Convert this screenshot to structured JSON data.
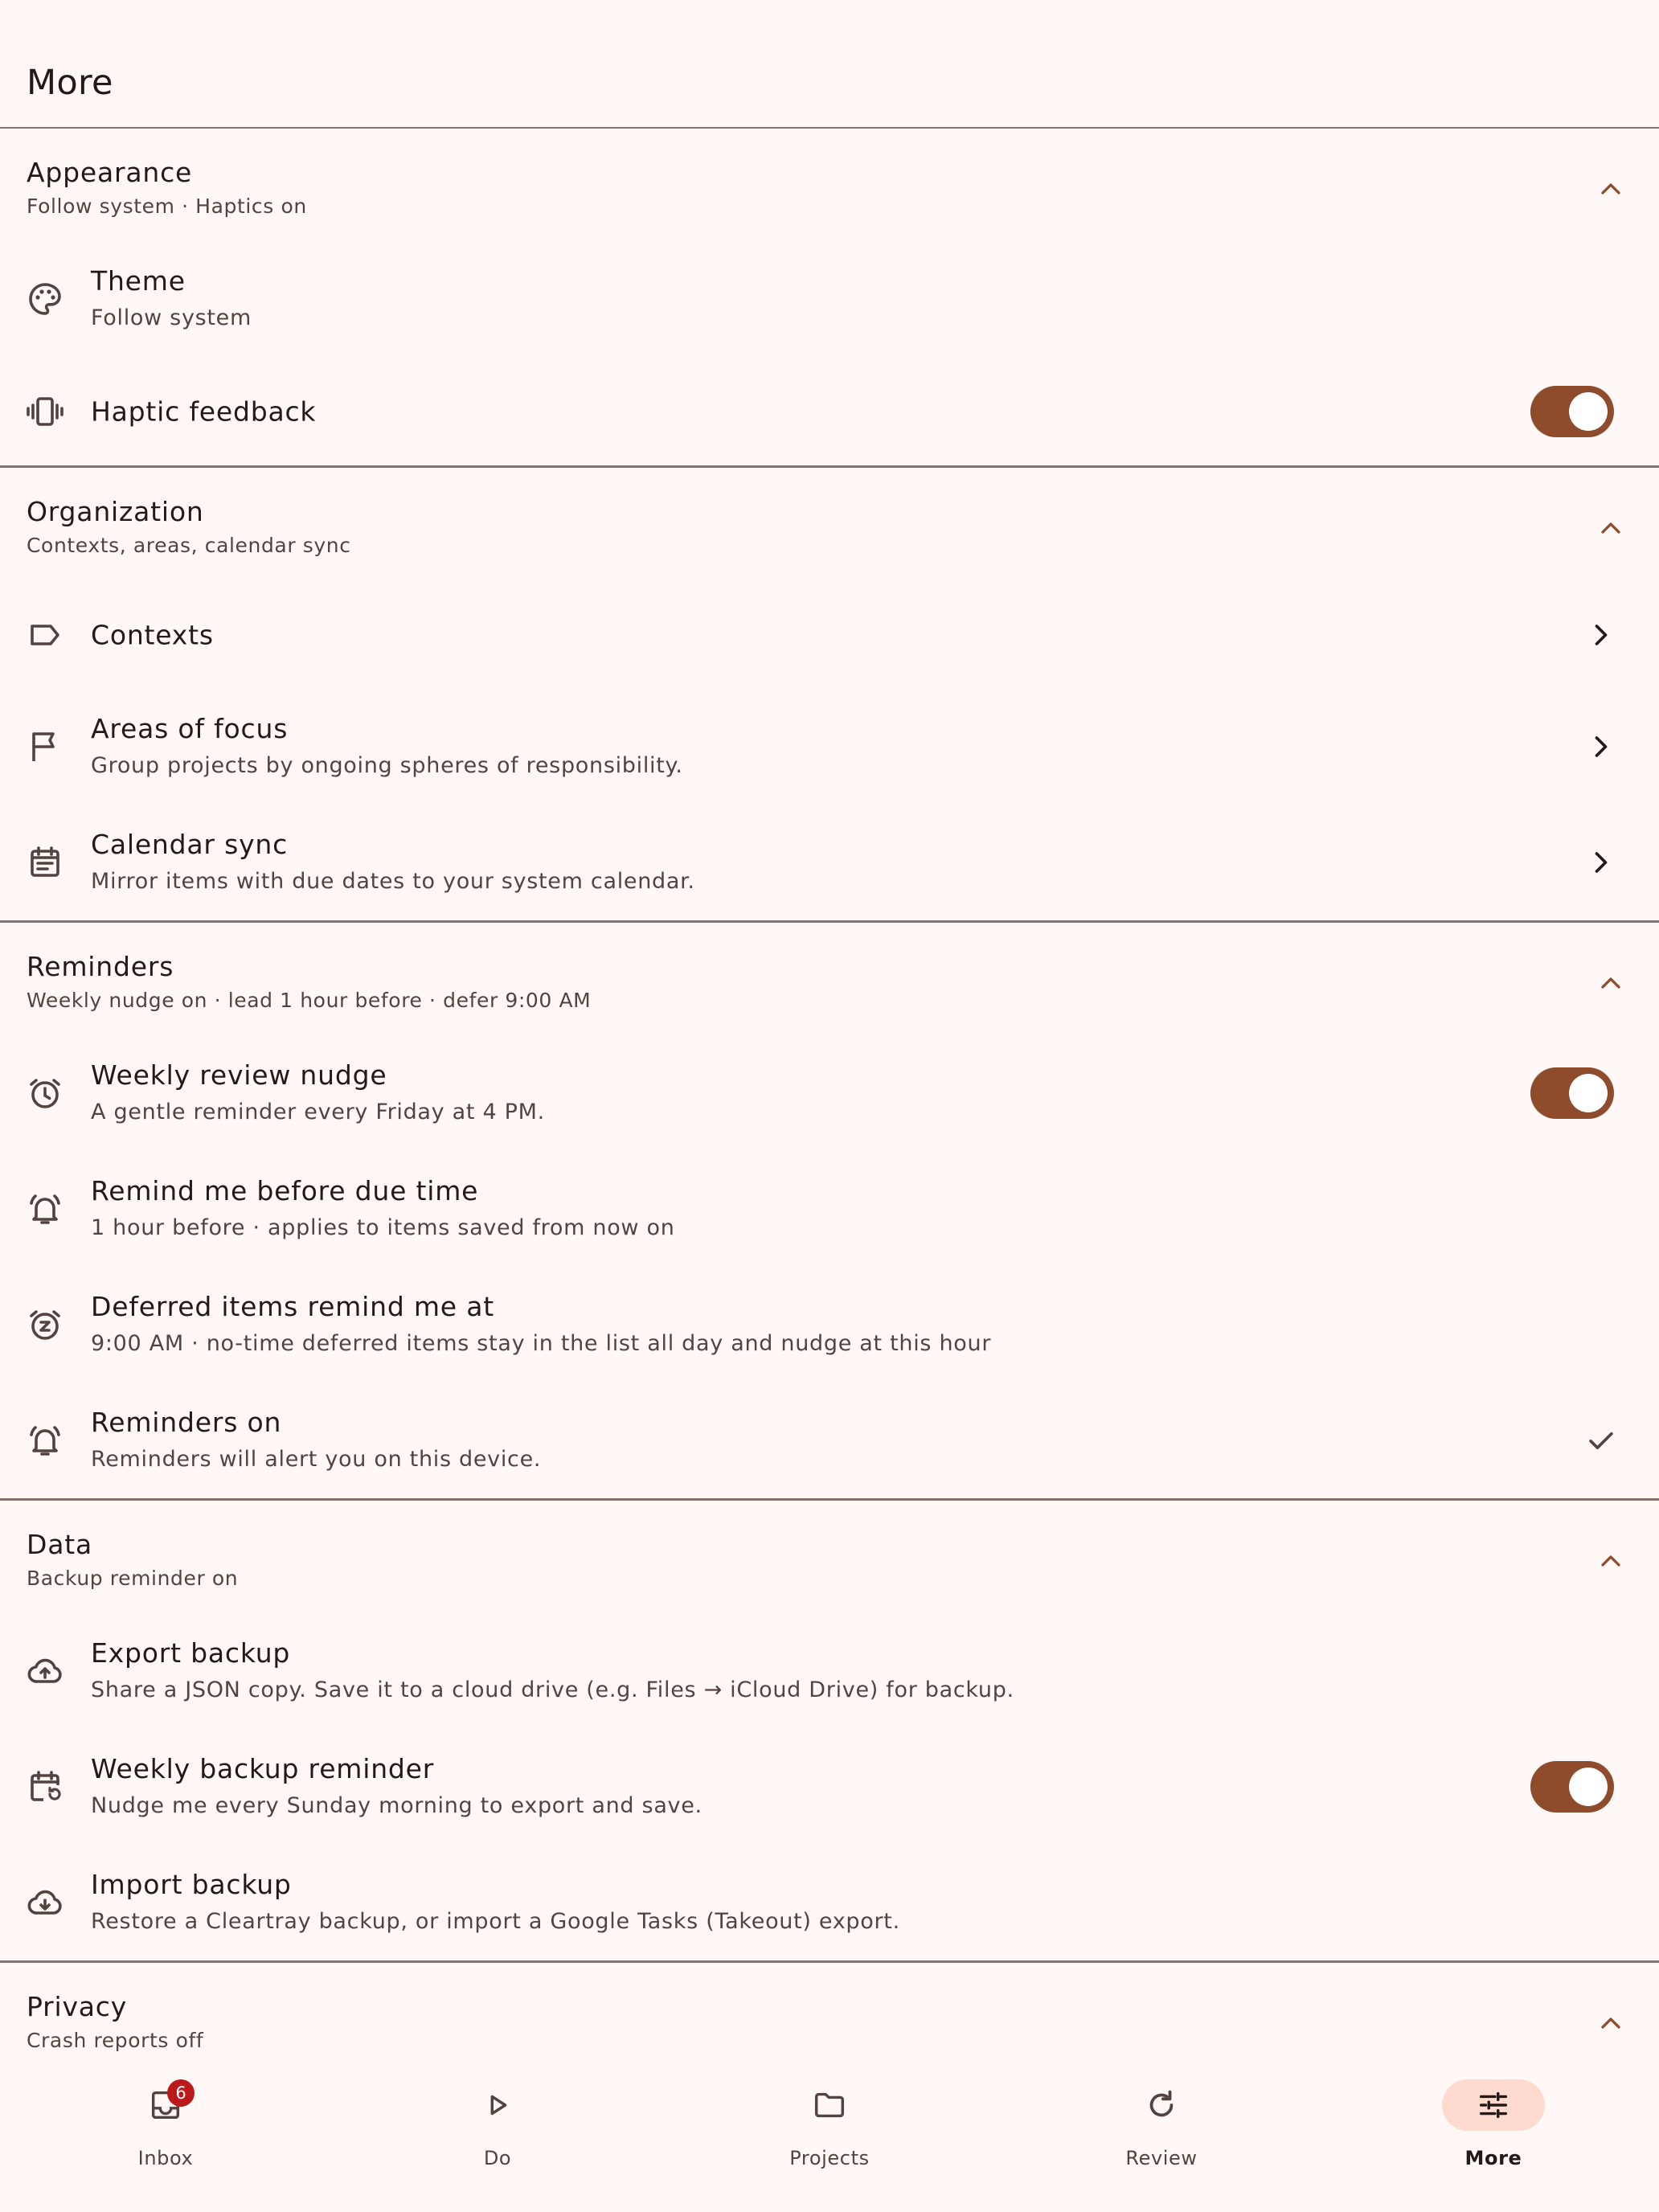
{
  "page": {
    "title": "More"
  },
  "sections": {
    "appearance": {
      "title": "Appearance",
      "summary": "Follow system · Haptics on",
      "theme": {
        "title": "Theme",
        "subtitle": "Follow system"
      },
      "haptics": {
        "title": "Haptic feedback",
        "enabled": true
      }
    },
    "organization": {
      "title": "Organization",
      "summary": "Contexts, areas, calendar sync",
      "contexts": {
        "title": "Contexts"
      },
      "areas": {
        "title": "Areas of focus",
        "subtitle": "Group projects by ongoing spheres of responsibility."
      },
      "calendar": {
        "title": "Calendar sync",
        "subtitle": "Mirror items with due dates to your system calendar."
      }
    },
    "reminders": {
      "title": "Reminders",
      "summary": "Weekly nudge on · lead 1 hour before · defer 9:00 AM",
      "weekly": {
        "title": "Weekly review nudge",
        "subtitle": "A gentle reminder every Friday at 4 PM.",
        "enabled": true
      },
      "lead": {
        "title": "Remind me before due time",
        "subtitle": "1 hour before · applies to items saved from now on"
      },
      "deferred": {
        "title": "Deferred items remind me at",
        "subtitle": "9:00 AM · no-time deferred items stay in the list all day and nudge at this hour"
      },
      "status": {
        "title": "Reminders on",
        "subtitle": "Reminders will alert you on this device."
      }
    },
    "data": {
      "title": "Data",
      "summary": "Backup reminder on",
      "export": {
        "title": "Export backup",
        "subtitle": "Share a JSON copy. Save it to a cloud drive (e.g. Files → iCloud Drive) for backup."
      },
      "weekly_backup": {
        "title": "Weekly backup reminder",
        "subtitle": "Nudge me every Sunday morning to export and save.",
        "enabled": true
      },
      "import": {
        "title": "Import backup",
        "subtitle": "Restore a Cleartray backup, or import a Google Tasks (Takeout) export."
      }
    },
    "privacy": {
      "title": "Privacy",
      "summary": "Crash reports off"
    }
  },
  "bottom_nav": {
    "items": [
      {
        "label": "Inbox",
        "badge": "6"
      },
      {
        "label": "Do"
      },
      {
        "label": "Projects"
      },
      {
        "label": "Review"
      },
      {
        "label": "More",
        "active": true
      }
    ]
  },
  "colors": {
    "accent": "#8f4c2c",
    "background": "#fff8f6",
    "divider": "#85736f",
    "badge": "#ba1a1a",
    "active_pill": "#ffdbcf"
  }
}
